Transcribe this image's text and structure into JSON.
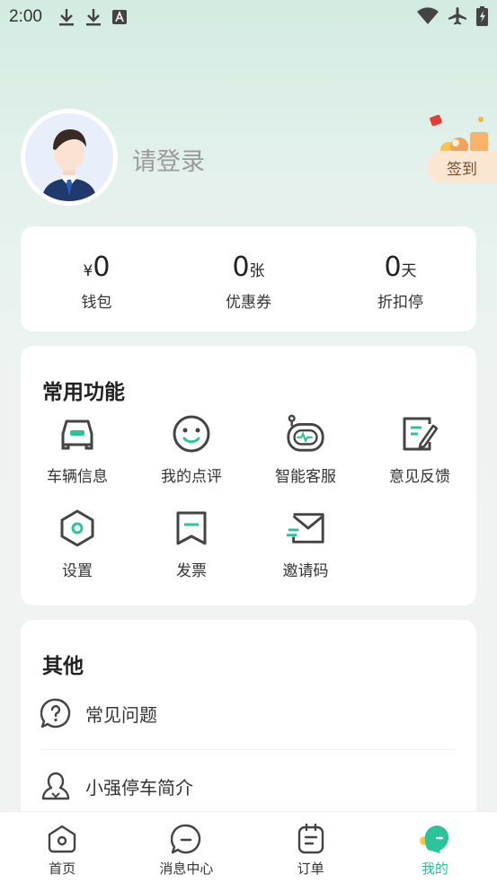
{
  "status_bar": {
    "time": "2:00",
    "icons": [
      "download-icon",
      "download-icon",
      "font-icon",
      "wifi-icon",
      "airplane-icon",
      "battery-icon"
    ]
  },
  "profile": {
    "login_prompt": "请登录",
    "signin_label": "签到"
  },
  "stats": [
    {
      "prefix": "¥",
      "value": "0",
      "suffix": "",
      "label": "钱包"
    },
    {
      "prefix": "",
      "value": "0",
      "suffix": "张",
      "label": "优惠券"
    },
    {
      "prefix": "",
      "value": "0",
      "suffix": "天",
      "label": "折扣停"
    }
  ],
  "functions": {
    "title": "常用功能",
    "items": [
      {
        "label": "车辆信息",
        "icon": "car-icon"
      },
      {
        "label": "我的点评",
        "icon": "smile-icon"
      },
      {
        "label": "智能客服",
        "icon": "robot-icon"
      },
      {
        "label": "意见反馈",
        "icon": "feedback-icon"
      },
      {
        "label": "设置",
        "icon": "settings-icon"
      },
      {
        "label": "发票",
        "icon": "invoice-icon"
      },
      {
        "label": "邀请码",
        "icon": "mail-icon"
      }
    ]
  },
  "others": {
    "title": "其他",
    "items": [
      {
        "label": "常见问题",
        "icon": "question-icon"
      },
      {
        "label": "小强停车简介",
        "icon": "person-icon"
      }
    ]
  },
  "tabbar": {
    "items": [
      {
        "label": "首页",
        "icon": "home-icon",
        "active": false
      },
      {
        "label": "消息中心",
        "icon": "message-icon",
        "active": false
      },
      {
        "label": "订单",
        "icon": "order-icon",
        "active": false
      },
      {
        "label": "我的",
        "icon": "mine-icon",
        "active": true
      }
    ],
    "accent_color": "#2cc29a"
  }
}
